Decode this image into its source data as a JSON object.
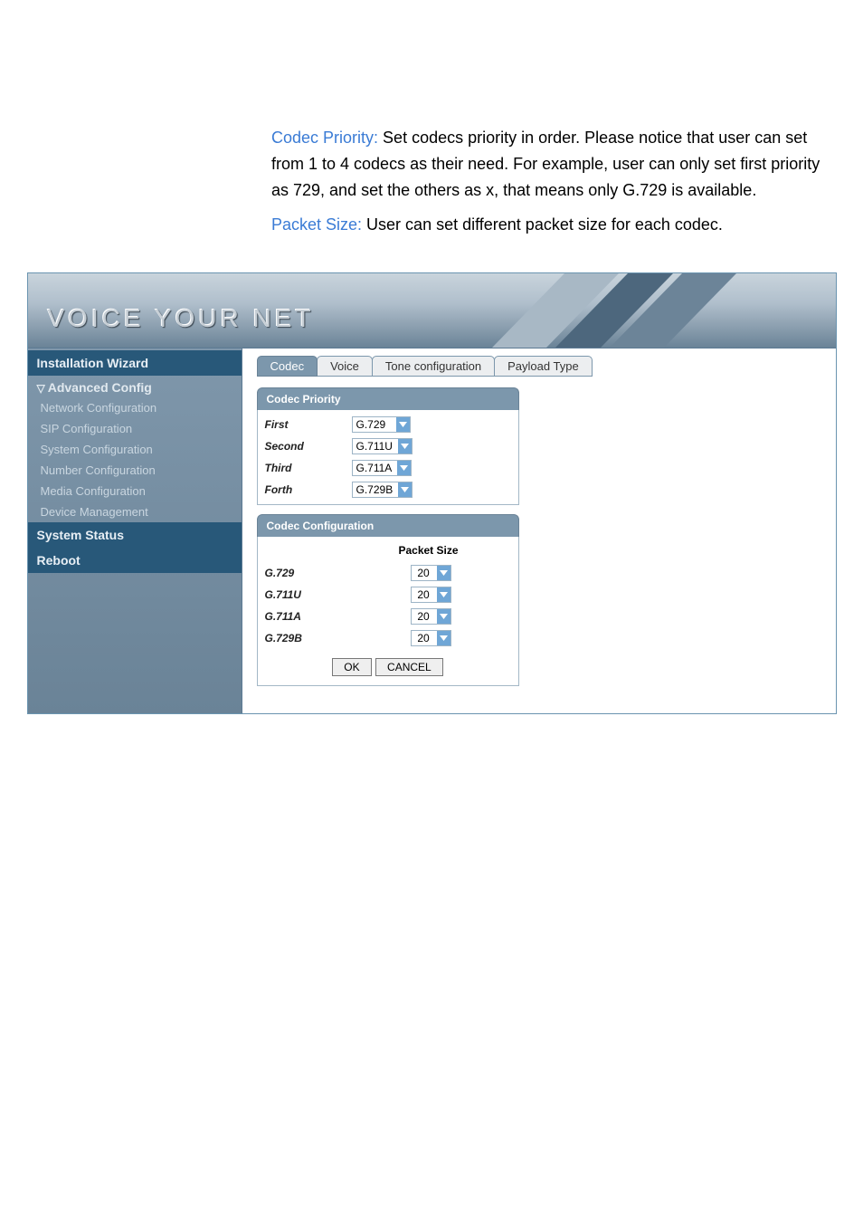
{
  "doc": {
    "codec_priority_label": "Codec Priority: ",
    "codec_priority_text": "Set codecs priority in order. Please notice that user can set from 1 to 4 codecs as their need. For example, user can only set first priority as 729, and set the others as x, that means only G.729 is available.",
    "packet_size_label": "Packet Size: ",
    "packet_size_text": "User can set different packet size for each codec."
  },
  "banner": {
    "title": "VOICE YOUR NET"
  },
  "sidebar": {
    "install_wizard": "Installation Wizard",
    "adv_config": "Advanced Config",
    "items": [
      "Network Configuration",
      "SIP Configuration",
      "System Configuration",
      "Number Configuration",
      "Media Configuration",
      "Device Management"
    ],
    "system_status": "System Status",
    "reboot": "Reboot"
  },
  "tabs": {
    "codec": "Codec",
    "voice": "Voice",
    "tone": "Tone configuration",
    "payload": "Payload Type"
  },
  "priority": {
    "title": "Codec Priority",
    "rows": [
      {
        "label": "First",
        "value": "G.729"
      },
      {
        "label": "Second",
        "value": "G.711U"
      },
      {
        "label": "Third",
        "value": "G.711A"
      },
      {
        "label": "Forth",
        "value": "G.729B"
      }
    ]
  },
  "config": {
    "title": "Codec Configuration",
    "packet_header": "Packet Size",
    "rows": [
      {
        "label": "G.729",
        "value": "20"
      },
      {
        "label": "G.711U",
        "value": "20"
      },
      {
        "label": "G.711A",
        "value": "20"
      },
      {
        "label": "G.729B",
        "value": "20"
      }
    ]
  },
  "buttons": {
    "ok": "OK",
    "cancel": "CANCEL"
  }
}
